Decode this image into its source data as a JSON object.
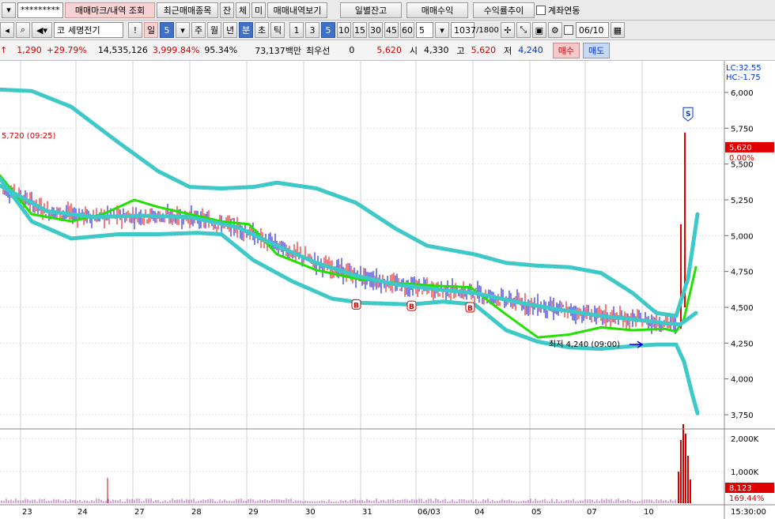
{
  "toolbar1": {
    "account_mask": "*********",
    "trade_mark_btn": "매매마크/내역 조회",
    "recent_btn": "최근매매종목",
    "btn_jan": "잔",
    "btn_che": "체",
    "btn_mi": "미",
    "history_btn": "매매내역보기",
    "daily_btn": "일별잔고",
    "profit_btn": "매매수익",
    "trend_btn": "수익률추이",
    "account_link": "계좌연동"
  },
  "toolbar2": {
    "market_prefix": "코",
    "stock_name": "세명전기",
    "excl": "!",
    "period_label": "일",
    "period_value": "5",
    "periods": [
      "주",
      "월",
      "년",
      "분",
      "초",
      "틱"
    ],
    "minutes": [
      "1",
      "3",
      "5",
      "10",
      "15",
      "30",
      "45",
      "60"
    ],
    "interval_value": "5",
    "count_value": "1037",
    "count_total": "/1800",
    "date_value": "06/10"
  },
  "info": {
    "change_arrow": "↑",
    "change": "1,290",
    "change_rate": "+29.79%",
    "volume": "14,535,126",
    "volume_rate": "3,999.84%",
    "turnover": "95.34%",
    "amount": "73,137백만",
    "preferred_label": "최우선",
    "preferred_value": "0",
    "price": "5,620",
    "open_label": "시",
    "open": "4,330",
    "high_label": "고",
    "high": "5,620",
    "low_label": "저",
    "low": "4,240",
    "buy_btn": "매수",
    "sell_btn": "매도"
  },
  "chart_data": {
    "type": "line",
    "corner_labels": [
      "LC:32.55",
      "HC:-1.75"
    ],
    "price_ticks": [
      "6,000",
      "5,750",
      "5,500",
      "5,250",
      "5,000",
      "4,750",
      "4,500",
      "4,250",
      "4,000",
      "3,750"
    ],
    "volume_ticks": [
      "2,000K",
      "1,000K"
    ],
    "date_ticks": [
      "23",
      "24",
      "27",
      "28",
      "29",
      "30",
      "31",
      "06/03",
      "04",
      "05",
      "07",
      "10"
    ],
    "time_label": "15:30:00",
    "high_annotation": "5,720 (09:25)",
    "low_annotation": "최저 4,240 (09:00)",
    "last_price": "5,620",
    "last_change": "0.00%",
    "last_volume": "8,123",
    "last_volume_rate": "169.44%",
    "buy_markers": [
      "B",
      "B",
      "B"
    ],
    "sell_marker": "S",
    "colors": {
      "band": "#3ec8c8",
      "ma": "#22e000",
      "up": "#e00000",
      "down": "#0000d0",
      "price_flag": "#e00000"
    },
    "ylim": [
      3700,
      6100
    ],
    "series": [
      {
        "values": [
          [
            0,
            5420
          ],
          [
            40,
            5150
          ],
          [
            90,
            5100
          ],
          [
            130,
            5150
          ],
          [
            170,
            5250
          ],
          [
            200,
            5200
          ],
          [
            240,
            5150
          ],
          [
            280,
            5100
          ],
          [
            315,
            5080
          ],
          [
            350,
            4870
          ],
          [
            400,
            4760
          ],
          [
            450,
            4700
          ],
          [
            500,
            4670
          ],
          [
            550,
            4650
          ],
          [
            595,
            4640
          ],
          [
            640,
            4450
          ],
          [
            680,
            4290
          ],
          [
            720,
            4310
          ],
          [
            760,
            4360
          ],
          [
            800,
            4340
          ],
          [
            840,
            4350
          ],
          [
            855,
            4330
          ],
          [
            865,
            4420
          ],
          [
            880,
            4780
          ]
        ]
      },
      {
        "values": [
          [
            0,
            6020
          ],
          [
            40,
            6010
          ],
          [
            90,
            5900
          ],
          [
            150,
            5650
          ],
          [
            200,
            5450
          ],
          [
            240,
            5340
          ],
          [
            280,
            5330
          ],
          [
            320,
            5340
          ],
          [
            350,
            5370
          ],
          [
            400,
            5330
          ],
          [
            450,
            5230
          ],
          [
            500,
            5050
          ],
          [
            540,
            4930
          ],
          [
            600,
            4870
          ],
          [
            640,
            4810
          ],
          [
            680,
            4790
          ],
          [
            720,
            4780
          ],
          [
            760,
            4740
          ],
          [
            800,
            4600
          ],
          [
            830,
            4460
          ],
          [
            855,
            4440
          ],
          [
            870,
            4700
          ],
          [
            882,
            5150
          ]
        ]
      },
      {
        "values": [
          [
            0,
            5400
          ],
          [
            40,
            5100
          ],
          [
            90,
            4980
          ],
          [
            150,
            5010
          ],
          [
            200,
            5010
          ],
          [
            250,
            5020
          ],
          [
            280,
            5010
          ],
          [
            320,
            4830
          ],
          [
            370,
            4680
          ],
          [
            420,
            4560
          ],
          [
            460,
            4530
          ],
          [
            520,
            4520
          ],
          [
            560,
            4540
          ],
          [
            600,
            4520
          ],
          [
            640,
            4340
          ],
          [
            680,
            4260
          ],
          [
            720,
            4220
          ],
          [
            760,
            4210
          ],
          [
            800,
            4230
          ],
          [
            830,
            4240
          ],
          [
            855,
            4240
          ],
          [
            865,
            4120
          ],
          [
            875,
            3900
          ],
          [
            882,
            3760
          ]
        ]
      },
      {
        "values": [
          [
            0,
            5350
          ],
          [
            60,
            5170
          ],
          [
            120,
            5130
          ],
          [
            180,
            5140
          ],
          [
            240,
            5130
          ],
          [
            300,
            5060
          ],
          [
            350,
            4930
          ],
          [
            400,
            4810
          ],
          [
            450,
            4720
          ],
          [
            500,
            4660
          ],
          [
            560,
            4620
          ],
          [
            600,
            4600
          ],
          [
            650,
            4540
          ],
          [
            700,
            4490
          ],
          [
            760,
            4440
          ],
          [
            810,
            4410
          ],
          [
            840,
            4390
          ],
          [
            860,
            4380
          ],
          [
            880,
            4460
          ]
        ]
      }
    ]
  }
}
